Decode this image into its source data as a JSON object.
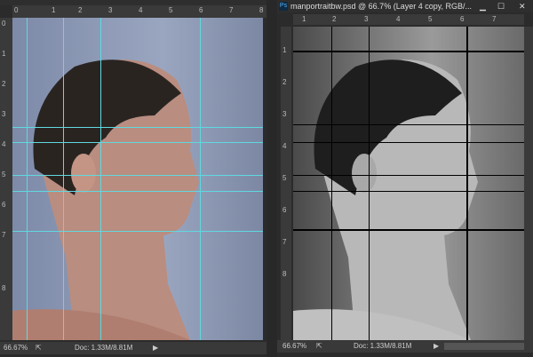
{
  "left_window": {
    "ruler_x": [
      "0",
      "1",
      "2",
      "3",
      "4",
      "5",
      "6",
      "7",
      "8"
    ],
    "ruler_y": [
      "0",
      "1",
      "2",
      "3",
      "4",
      "5",
      "6",
      "7",
      "8"
    ],
    "zoom": "66.67%",
    "doc": "Doc: 1.33M/8.81M",
    "guide_color": "#5fd9e0"
  },
  "right_window": {
    "ps_icon": "Ps",
    "title": "manportraitbw.psd @ 66.7% (Layer 4 copy, RGB/...",
    "ruler_x": [
      "1",
      "2",
      "3",
      "4",
      "5",
      "6",
      "7"
    ],
    "ruler_y": [
      "1",
      "2",
      "3",
      "4",
      "5",
      "6",
      "7",
      "8"
    ],
    "zoom": "66.67%",
    "doc": "Doc: 1.33M/8.81M",
    "guide_color": "#000000"
  }
}
